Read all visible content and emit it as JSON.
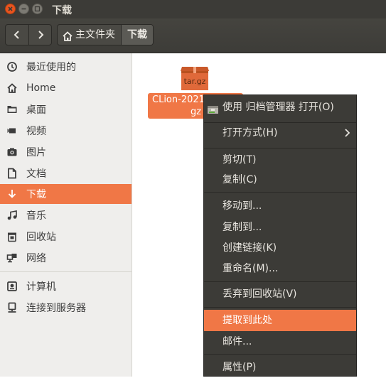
{
  "window": {
    "title": "下载"
  },
  "toolbar": {
    "breadcrumb_home": "主文件夹",
    "breadcrumb_current": "下载"
  },
  "sidebar": {
    "items": [
      {
        "label": "最近使用的",
        "icon": "clock-icon"
      },
      {
        "label": "Home",
        "icon": "home-icon"
      },
      {
        "label": "桌面",
        "icon": "folder-icon"
      },
      {
        "label": "视频",
        "icon": "video-icon"
      },
      {
        "label": "图片",
        "icon": "camera-icon"
      },
      {
        "label": "文档",
        "icon": "document-icon"
      },
      {
        "label": "下载",
        "icon": "download-icon",
        "active": true
      },
      {
        "label": "音乐",
        "icon": "music-icon"
      },
      {
        "label": "回收站",
        "icon": "trash-icon"
      },
      {
        "label": "网络",
        "icon": "network-icon"
      },
      {
        "label": "计算机",
        "icon": "computer-icon"
      },
      {
        "label": "连接到服务器",
        "icon": "server-icon"
      }
    ]
  },
  "content": {
    "file": {
      "icon_label": "tar.gz",
      "name_line1": "CLion-2021",
      "name_line2": "gz"
    }
  },
  "context_menu": {
    "items": [
      {
        "label": "使用 归档管理器 打开(O)"
      },
      {
        "label": "打开方式(H)"
      },
      {
        "label": "剪切(T)"
      },
      {
        "label": "复制(C)"
      },
      {
        "label": "移动到..."
      },
      {
        "label": "复制到..."
      },
      {
        "label": "创建链接(K)"
      },
      {
        "label": "重命名(M)..."
      },
      {
        "label": "丢弃到回收站(V)"
      },
      {
        "label": "提取到此处",
        "highlighted": true
      },
      {
        "label": "邮件..."
      },
      {
        "label": "属性(P)"
      }
    ]
  },
  "colors": {
    "accent": "#f07746",
    "titlebar": "#3c3b37",
    "sidebar_bg": "#efeeec",
    "menu_bg": "#3c3b37"
  }
}
